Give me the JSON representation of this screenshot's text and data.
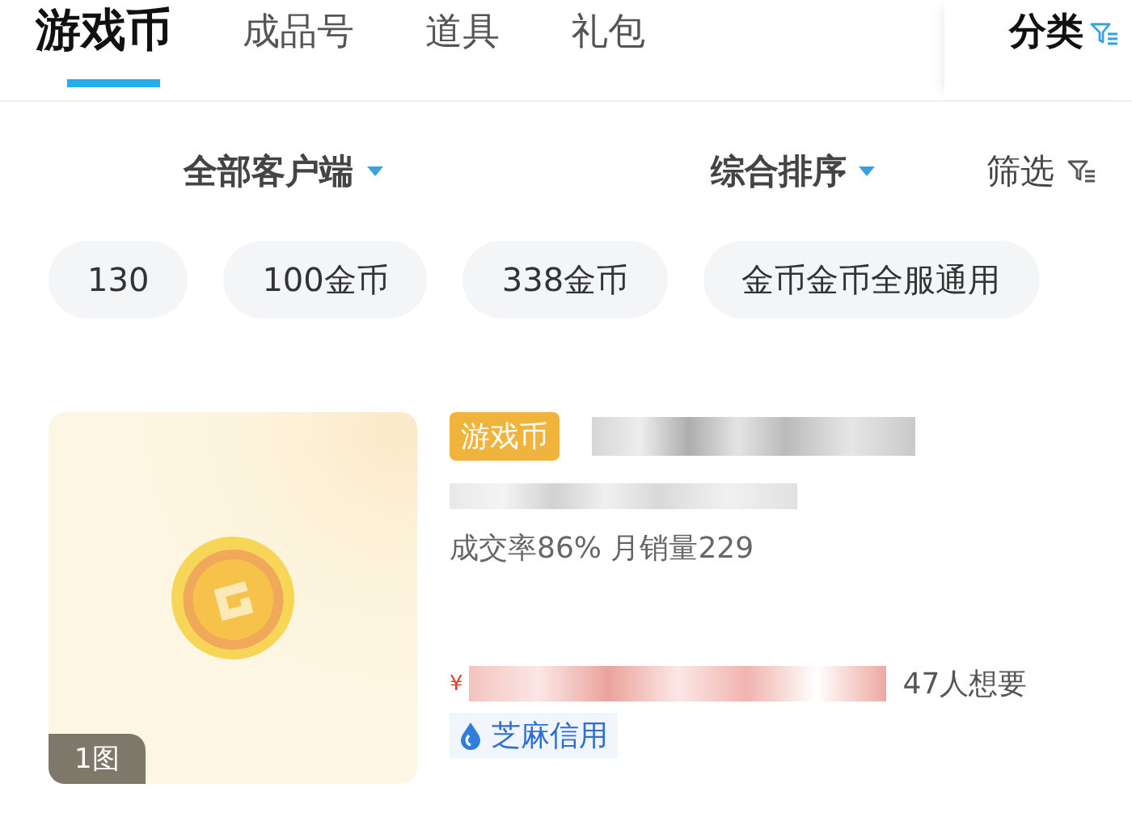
{
  "tabs": [
    {
      "label": "游戏币",
      "selected": true
    },
    {
      "label": "成品号",
      "selected": false
    },
    {
      "label": "道具",
      "selected": false
    },
    {
      "label": "礼包",
      "selected": false
    }
  ],
  "category_button": {
    "label": "分类"
  },
  "filters": [
    {
      "label": "全部客户端",
      "kind": "dropdown"
    },
    {
      "label": "综合排序",
      "kind": "dropdown"
    },
    {
      "label": "筛选",
      "kind": "filter"
    }
  ],
  "chips": [
    {
      "label": "130"
    },
    {
      "label": "100金币"
    },
    {
      "label": "338金币"
    },
    {
      "label": "金币金币全服通用"
    }
  ],
  "listing": {
    "image_count": "1图",
    "tag": "游戏币",
    "stats": "成交率86% 月销量229",
    "currency": "¥",
    "wants": "47人想要",
    "credit": "芝麻信用"
  }
}
